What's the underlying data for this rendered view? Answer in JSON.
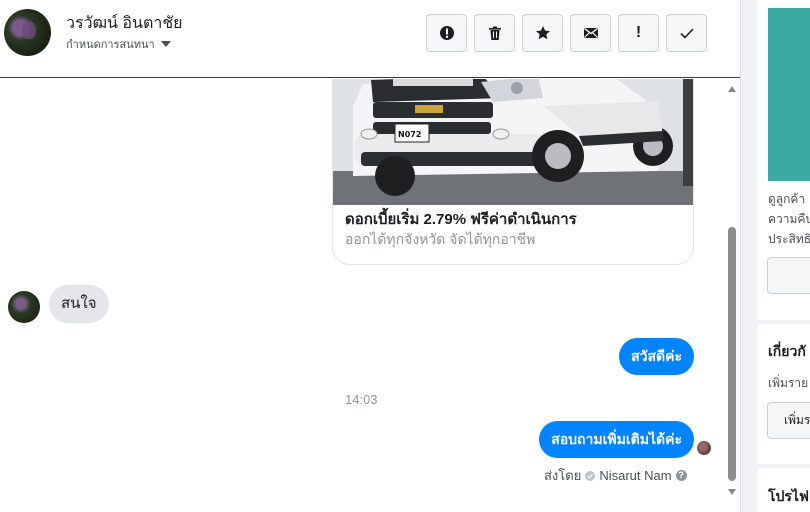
{
  "header": {
    "contact_name": "วรวัฒน์ อินตาชัย",
    "conversation_status": "กำหนดการสนทนา",
    "toolbar": [
      {
        "icon": "alert-circle-icon",
        "glyph": "!"
      },
      {
        "icon": "trash-icon",
        "glyph": ""
      },
      {
        "icon": "star-icon",
        "glyph": "★"
      },
      {
        "icon": "mail-icon",
        "glyph": "✉"
      },
      {
        "icon": "exclamation-icon",
        "glyph": "!"
      },
      {
        "icon": "checkmark-icon",
        "glyph": "✓"
      }
    ]
  },
  "conversation": {
    "ad_card": {
      "title": "ดอกเบี้ยเริ่ม 2.79% ฟรีค่าดำเนินการ",
      "subtitle": "ออกได้ทุกจังหวัด จัดได้ทุกอาชีพ",
      "plate_text": "N072"
    },
    "incoming_message": "สนใจ",
    "outgoing_messages": [
      "สวัสดีค่ะ",
      "สอบถามเพิ่มเติมได้ค่ะ"
    ],
    "timestamp": "14:03",
    "sent_by_label": "ส่งโดย",
    "sent_by_name": "Nisarut Nam"
  },
  "right_panel": {
    "description_lines": [
      "ดูลูกค้า",
      "ความคืบ",
      "ประสิทธิ"
    ],
    "section_title_1": "เกี่ยวกั",
    "section_text_1": "เพิ่มราย",
    "section_button_1": "เพิ่มร",
    "section_title_2": "โปรไฟ"
  },
  "colors": {
    "outgoing_bubble": "#0084ff",
    "incoming_bubble": "#e4e6eb",
    "accent_teal": "#3aa99f"
  }
}
